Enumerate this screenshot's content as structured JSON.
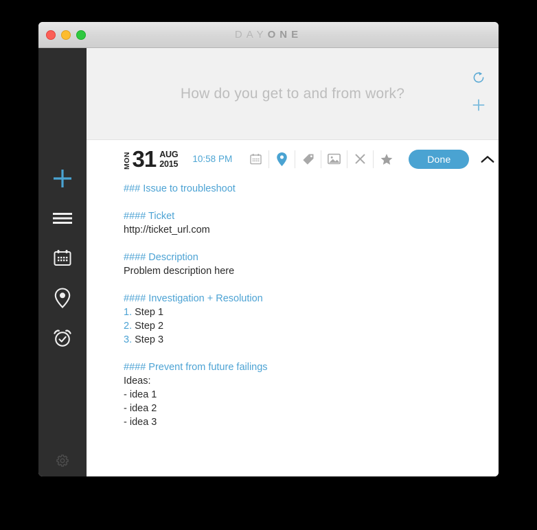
{
  "window": {
    "title_light": "DAY",
    "title_bold": "ONE",
    "traffic_lights": [
      {
        "name": "close",
        "color": "#fb5f57"
      },
      {
        "name": "minimize",
        "color": "#fdbc2e"
      },
      {
        "name": "maximize",
        "color": "#2fc840"
      }
    ]
  },
  "sidebar": {
    "background": "#2e2e2e",
    "accent": "#4aa3d2",
    "items": [
      {
        "icon": "plus-icon",
        "label": "New Entry"
      },
      {
        "icon": "hamburger-menu-icon",
        "label": "Entries"
      },
      {
        "icon": "calendar-icon",
        "label": "Calendar"
      },
      {
        "icon": "map-pin-icon",
        "label": "Map"
      },
      {
        "icon": "alarm-clock-icon",
        "label": "Reminders"
      }
    ],
    "settings": {
      "icon": "gear-icon",
      "label": "Settings"
    }
  },
  "prompt": {
    "text": "How do you get to and from work?",
    "actions": [
      {
        "icon": "refresh-icon",
        "label": "New prompt"
      },
      {
        "icon": "plus-icon",
        "label": "Add entry from prompt"
      }
    ]
  },
  "entry": {
    "date": {
      "day_of_week": "MON",
      "day": "31",
      "month": "AUG",
      "year": "2015"
    },
    "time": "10:58 PM",
    "tools": [
      {
        "icon": "calendar-icon",
        "label": "Date",
        "active": false
      },
      {
        "icon": "map-pin-icon",
        "label": "Location",
        "active": true
      },
      {
        "icon": "tag-icon",
        "label": "Tags",
        "active": false
      },
      {
        "icon": "image-icon",
        "label": "Photo",
        "active": false
      },
      {
        "icon": "close-icon",
        "label": "Delete",
        "active": false
      },
      {
        "icon": "star-icon",
        "label": "Favorite",
        "active": false
      }
    ],
    "done_label": "Done",
    "collapse_icon": "chevron-up-icon",
    "content_lines": [
      {
        "type": "heading",
        "text": "### Issue to troubleshoot"
      },
      {
        "type": "blank",
        "text": ""
      },
      {
        "type": "heading",
        "text": "#### Ticket"
      },
      {
        "type": "text",
        "text": "http://ticket_url.com"
      },
      {
        "type": "blank",
        "text": ""
      },
      {
        "type": "heading",
        "text": "#### Description"
      },
      {
        "type": "text",
        "text": "Problem description here"
      },
      {
        "type": "blank",
        "text": ""
      },
      {
        "type": "heading",
        "text": "#### Investigation + Resolution"
      },
      {
        "type": "ordered",
        "marker": "1.",
        "text": "Step 1"
      },
      {
        "type": "ordered",
        "marker": "2.",
        "text": "Step 2"
      },
      {
        "type": "ordered",
        "marker": "3.",
        "text": "Step 3"
      },
      {
        "type": "blank",
        "text": ""
      },
      {
        "type": "heading",
        "text": "#### Prevent from future failings"
      },
      {
        "type": "text",
        "text": "Ideas:"
      },
      {
        "type": "text",
        "text": "- idea 1"
      },
      {
        "type": "text",
        "text": "- idea 2"
      },
      {
        "type": "text",
        "text": "- idea 3"
      }
    ]
  },
  "colors": {
    "accent_blue": "#4aa3d2",
    "heading_blue": "#4da3d4",
    "sidebar_dark": "#2e2e2e",
    "prompt_bg": "#f1f1f1",
    "body_text": "#2b2b2b"
  }
}
